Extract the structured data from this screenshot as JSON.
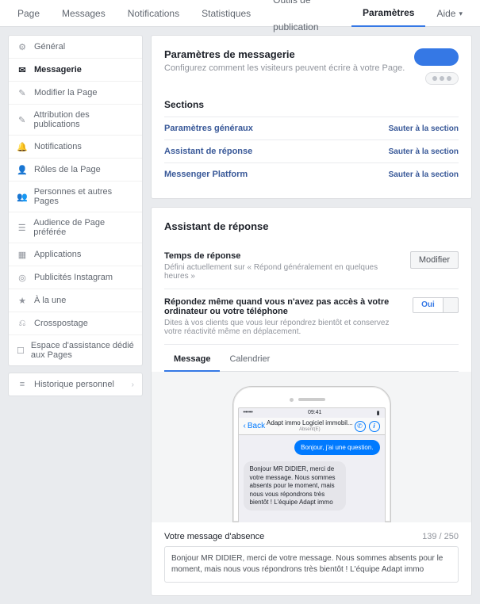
{
  "topnav": {
    "items": [
      "Page",
      "Messages",
      "Notifications",
      "Statistiques",
      "Outils de publication",
      "Paramètres",
      "Aide"
    ],
    "active_index": 5
  },
  "sidebar": {
    "group1": [
      {
        "icon": "⚙",
        "label": "Général"
      },
      {
        "icon": "✉",
        "label": "Messagerie"
      },
      {
        "icon": "✎",
        "label": "Modifier la Page"
      },
      {
        "icon": "✎",
        "label": "Attribution des publications"
      },
      {
        "icon": "🔔",
        "label": "Notifications"
      },
      {
        "icon": "👤",
        "label": "Rôles de la Page"
      },
      {
        "icon": "👥",
        "label": "Personnes et autres Pages"
      },
      {
        "icon": "☰",
        "label": "Audience de Page préférée"
      },
      {
        "icon": "▦",
        "label": "Applications"
      },
      {
        "icon": "◎",
        "label": "Publicités Instagram"
      },
      {
        "icon": "★",
        "label": "À la une"
      },
      {
        "icon": "⎌",
        "label": "Crosspostage"
      },
      {
        "icon": "☐",
        "label": "Espace d'assistance dédié aux Pages"
      }
    ],
    "active_index": 1,
    "group2": {
      "icon": "≡",
      "label": "Historique personnel"
    }
  },
  "messaging": {
    "title": "Paramètres de messagerie",
    "subtitle": "Configurez comment les visiteurs peuvent écrire à votre Page.",
    "sections_heading": "Sections",
    "sections": [
      {
        "label": "Paramètres généraux",
        "action": "Sauter à la section"
      },
      {
        "label": "Assistant de réponse",
        "action": "Sauter à la section"
      },
      {
        "label": "Messenger Platform",
        "action": "Sauter à la section"
      }
    ]
  },
  "assistant": {
    "title": "Assistant de réponse",
    "response_time": {
      "label": "Temps de réponse",
      "desc": "Défini actuellement sur « Répond généralement en quelques heures »",
      "button": "Modifier"
    },
    "away": {
      "label": "Répondez même quand vous n'avez pas accès à votre ordinateur ou votre téléphone",
      "desc": "Dites à vos clients que vous leur répondrez bientôt et conservez votre réactivité même en déplacement.",
      "toggle_on": "Oui"
    },
    "tabs": [
      "Message",
      "Calendrier"
    ],
    "phone": {
      "status_time": "09:41",
      "back": "Back",
      "nav_title": "Adapt immo Logiciel immobil...",
      "nav_sub": "Absent(E)",
      "user_msg": "Bonjour, j'ai une question.",
      "reply_msg": "Bonjour MR DIDIER, merci de votre message. Nous sommes absents pour le moment, mais nous vous répondrons très bientôt ! L'équipe Adapt immo"
    },
    "away_message": {
      "label": "Votre message d'absence",
      "count": "139 / 250",
      "text": "Bonjour MR DIDIER, merci de votre message. Nous sommes absents pour le moment, mais nous vous répondrons très bientôt ! L'équipe Adapt immo"
    }
  }
}
